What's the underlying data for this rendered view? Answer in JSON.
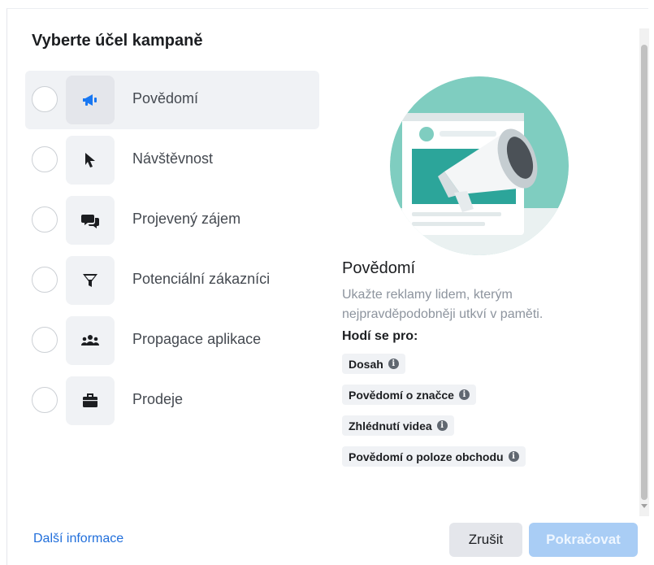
{
  "dialog": {
    "title": "Vyberte účel kampaně",
    "accent_color": "#1877f2"
  },
  "options": [
    {
      "label": "Povědomí",
      "icon": "megaphone-icon",
      "selected": true
    },
    {
      "label": "Návštěvnost",
      "icon": "cursor-icon",
      "selected": false
    },
    {
      "label": "Projevený zájem",
      "icon": "chat-bubbles-icon",
      "selected": false
    },
    {
      "label": "Potenciální zákazníci",
      "icon": "funnel-icon",
      "selected": false
    },
    {
      "label": "Propagace aplikace",
      "icon": "people-icon",
      "selected": false
    },
    {
      "label": "Prodeje",
      "icon": "briefcase-icon",
      "selected": false
    }
  ],
  "detail": {
    "title": "Povědomí",
    "description": "Ukažte reklamy lidem, kterým nejpravděpodobněji utkví v paměti.",
    "suited_label": "Hodí se pro:",
    "tags": [
      "Dosah",
      "Povědomí o značce",
      "Zhlédnutí videa",
      "Povědomí o poloze obchodu"
    ],
    "info_glyph": "i"
  },
  "footer": {
    "more_info": "Další informace",
    "cancel": "Zrušit",
    "continue": "Pokračovat"
  }
}
